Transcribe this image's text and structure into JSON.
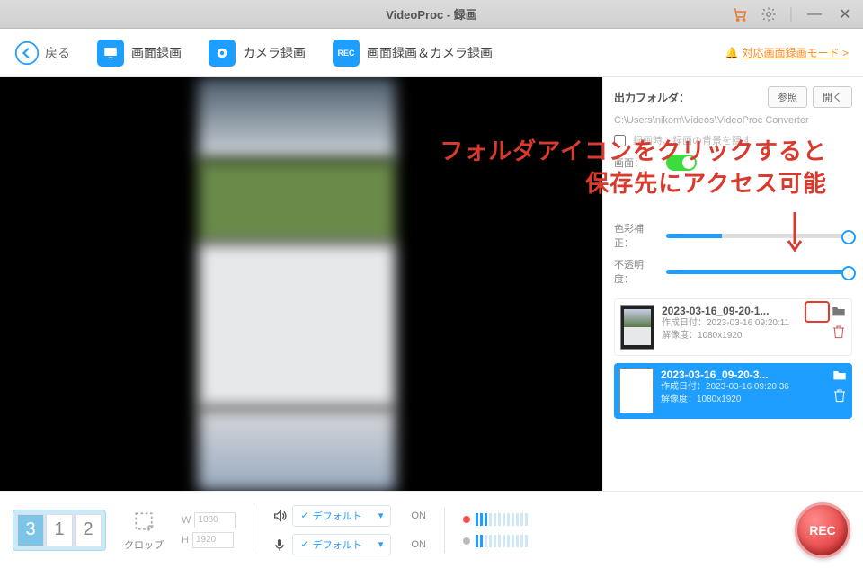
{
  "title": "VideoProc - 録画",
  "toolbar": {
    "back": "戻る",
    "screen_rec": "画面録画",
    "camera_rec": "カメラ録画",
    "screen_camera_rec": "画面録画＆カメラ録画",
    "mode_link": "対応画面録画モード >"
  },
  "sidepanel": {
    "output_folder_label": "出力フォルダ：",
    "browse": "参照",
    "open": "開く",
    "path": "C:\\Users\\nikom\\Videos\\VideoProc Converter",
    "hide_bg_label": "録画時、録画の背景を隠す",
    "screen_when_label": "画面：",
    "color_adjust_label": "色彩補正：",
    "opacity_label": "不透明度："
  },
  "recordings": [
    {
      "name": "2023-03-16_09-20-1...",
      "created_label": "作成日付：",
      "created": "2023-03-16 09:20:11",
      "res_label": "解像度：",
      "res": "1080x1920",
      "selected": false
    },
    {
      "name": "2023-03-16_09-20-3...",
      "created_label": "作成日付：",
      "created": "2023-03-16 09:20:36",
      "res_label": "解像度：",
      "res": "1080x1920",
      "selected": true
    }
  ],
  "bottom": {
    "monitors": [
      "3",
      "1",
      "2"
    ],
    "crop_label": "クロップ",
    "w": "W",
    "w_val": "1080",
    "h": "H",
    "h_val": "1920",
    "audio_default": "デフォルト",
    "on": "ON",
    "rec": "REC"
  },
  "annotation": {
    "line1": "フォルダアイコンをクリックすると",
    "line2": "保存先にアクセス可能"
  }
}
